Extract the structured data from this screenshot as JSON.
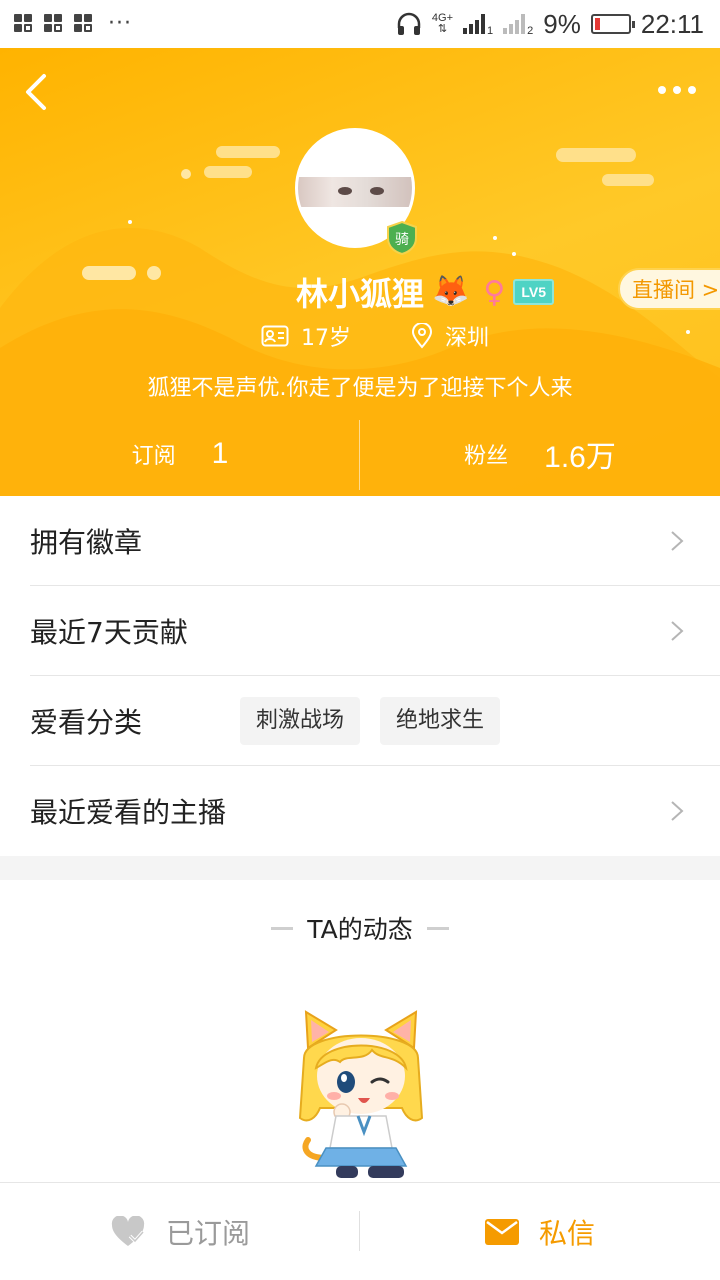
{
  "status_bar": {
    "network": "4G+",
    "sim1": "1",
    "sim2": "2",
    "battery": "9%",
    "time": "22:11"
  },
  "profile": {
    "name": "林小狐狸",
    "fox_emoji": "🦊",
    "gender_symbol": "♀",
    "level": "LV5",
    "knight_badge": "骑",
    "live_room_label": "直播间 >",
    "age": "17岁",
    "location": "深圳",
    "bio": "狐狸不是声优.你走了便是为了迎接下个人来"
  },
  "stats": {
    "subscribe_label": "订阅",
    "subscribe_value": "1",
    "fans_label": "粉丝",
    "fans_value": "1.6万"
  },
  "rows": {
    "badges": "拥有徽章",
    "contribution": "最近7天贡献",
    "categories_label": "爱看分类",
    "categories": [
      "刺激战场",
      "绝地求生"
    ],
    "favorite_streamers": "最近爱看的主播"
  },
  "feed": {
    "title": "TA的动态"
  },
  "bottom_bar": {
    "subscribed_label": "已订阅",
    "message_label": "私信"
  },
  "colors": {
    "header_yellow": "#ffc928",
    "accent_orange": "#f59b00",
    "level_teal": "#4fd3c4",
    "female_pink": "#ff7a9a"
  }
}
